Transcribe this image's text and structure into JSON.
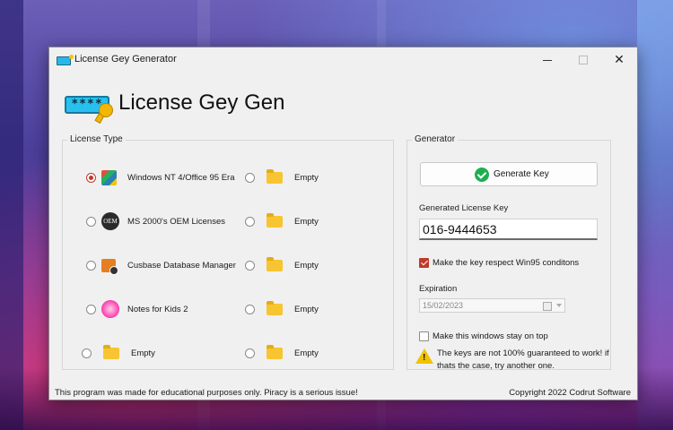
{
  "window": {
    "title": "License Gey Generator"
  },
  "header": {
    "app_title": "License Gey Gen",
    "logo_text": "****"
  },
  "license_type": {
    "legend": "License Type",
    "options": [
      {
        "label": "Windows NT 4/Office 95 Era",
        "icon": "windows-logo-icon",
        "selected": true
      },
      {
        "label": "MS 2000's OEM Licenses",
        "icon": "oem-badge-icon",
        "icon_text": "OEM",
        "selected": false
      },
      {
        "label": "Cusbase Database Manager",
        "icon": "database-manager-icon",
        "selected": false
      },
      {
        "label": "Notes for Kids 2",
        "icon": "notes-kids-icon",
        "selected": false
      },
      {
        "label": "Empty",
        "icon": "folder-icon",
        "selected": false
      },
      {
        "label": "Empty",
        "icon": "folder-icon",
        "selected": false
      },
      {
        "label": "Empty",
        "icon": "folder-icon",
        "selected": false
      },
      {
        "label": "Empty",
        "icon": "folder-icon",
        "selected": false
      },
      {
        "label": "Empty",
        "icon": "folder-icon",
        "selected": false
      },
      {
        "label": "Empty",
        "icon": "folder-icon",
        "selected": false
      }
    ]
  },
  "generator": {
    "legend": "Generator",
    "button_label": "Generate Key",
    "key_label": "Generated License Key",
    "key_value": "016-9444653",
    "respect_win95_label": "Make the key respect Win95 conditons",
    "respect_win95_checked": true,
    "expiration_label": "Expiration",
    "expiration_value": "15/02/2023",
    "stay_on_top_label": "Make this windows stay on top",
    "stay_on_top_checked": false,
    "warning_text": "The keys are not 100% guaranteed to work! if thats the case, try another one."
  },
  "footer": {
    "left": "This program was made for educational purposes only. Piracy is a serious issue!",
    "right": "Copyright 2022 Codrut Software"
  },
  "colors": {
    "accent": "#c0392b",
    "window_bg": "#f0f0f0",
    "success": "#1fae52",
    "warning": "#f2c200"
  }
}
